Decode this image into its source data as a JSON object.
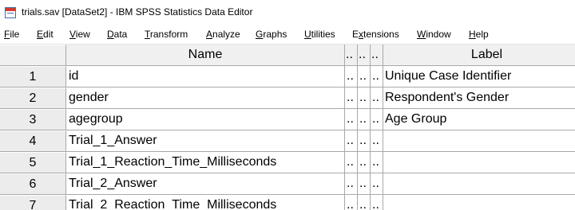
{
  "window": {
    "title": "trials.sav [DataSet2] - IBM SPSS Statistics Data Editor"
  },
  "menu": [
    {
      "label": "File",
      "mnemonic": "F",
      "rest": "ile"
    },
    {
      "label": "Edit",
      "mnemonic": "E",
      "rest": "dit"
    },
    {
      "label": "View",
      "mnemonic": "V",
      "rest": "iew"
    },
    {
      "label": "Data",
      "mnemonic": "D",
      "rest": "ata"
    },
    {
      "label": "Transform",
      "mnemonic": "T",
      "rest": "ransform"
    },
    {
      "label": "Analyze",
      "mnemonic": "A",
      "rest": "nalyze"
    },
    {
      "label": "Graphs",
      "mnemonic": "G",
      "rest": "raphs"
    },
    {
      "label": "Utilities",
      "mnemonic": "U",
      "rest": "tilities"
    },
    {
      "label": "Extensions",
      "pre": "E",
      "mnemonic": "x",
      "rest": "tensions"
    },
    {
      "label": "Window",
      "mnemonic": "W",
      "rest": "indow"
    },
    {
      "label": "Help",
      "mnemonic": "H",
      "rest": "elp"
    }
  ],
  "grid": {
    "headers": {
      "name": "Name",
      "dots": [
        "..",
        "..",
        ".."
      ],
      "label": "Label"
    },
    "rows": [
      {
        "num": "1",
        "name": "id",
        "dots": [
          "..",
          "..",
          ".."
        ],
        "label": "Unique Case Identifier"
      },
      {
        "num": "2",
        "name": "gender",
        "dots": [
          "..",
          "..",
          ".."
        ],
        "label": "Respondent's Gender"
      },
      {
        "num": "3",
        "name": "agegroup",
        "dots": [
          "..",
          "..",
          ".."
        ],
        "label": "Age Group"
      },
      {
        "num": "4",
        "name": "Trial_1_Answer",
        "dots": [
          "..",
          "..",
          ".."
        ],
        "label": ""
      },
      {
        "num": "5",
        "name": "Trial_1_Reaction_Time_Milliseconds",
        "dots": [
          "..",
          "..",
          ".."
        ],
        "label": ""
      },
      {
        "num": "6",
        "name": "Trial_2_Answer",
        "dots": [
          "..",
          "..",
          ".."
        ],
        "label": ""
      },
      {
        "num": "7",
        "name": "Trial_2_Reaction_Time_Milliseconds",
        "dots": [
          "..",
          "..",
          ".."
        ],
        "label": ""
      }
    ]
  }
}
